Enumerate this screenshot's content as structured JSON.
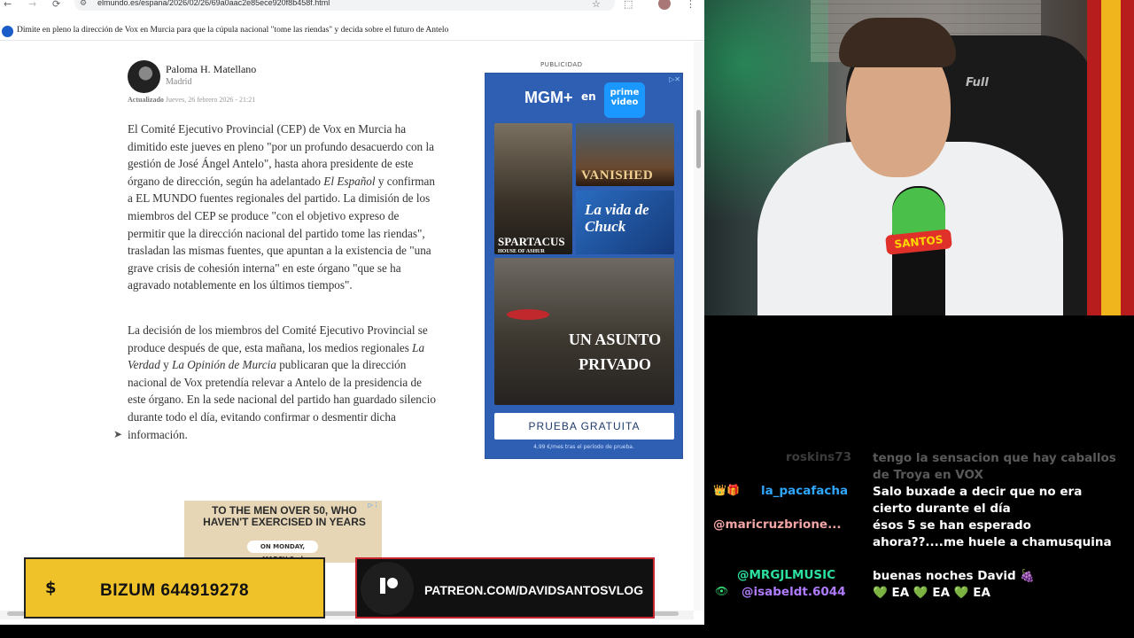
{
  "browser": {
    "url": "elmundo.es/espana/2026/02/26/69a0aac2e85ece920f8b458f.html",
    "tab_title": "Dimite en pleno la dirección de Vox en Murcia para que la cúpula nacional \"tome las riendas\" y decida sobre el futuro de Antelo",
    "icons": {
      "back": "←",
      "forward": "→",
      "reload": "⟳",
      "star": "☆",
      "extensions": "⬚",
      "menu": "⋮"
    }
  },
  "article": {
    "author_name": "Paloma H. Matellano",
    "author_city": "Madrid",
    "updated_label": "Actualizado",
    "updated_date": "Jueves, 26 febrero 2026 - 21:21",
    "paragraph1": {
      "a": "El Comité Ejecutivo Provincial (CEP) de Vox en Murcia ha dimitido este jueves en pleno \"por un profundo desacuerdo con la gestión de José Ángel Antelo\", hasta ahora presidente de este órgano de dirección, según ha adelantado ",
      "source": "El Español",
      "b": " y confirman a EL MUNDO fuentes regionales del partido. La dimisión de los miembros del CEP se produce \"con el objetivo expreso de permitir que la dirección nacional del partido tome las riendas\", trasladan las mismas fuentes, que apuntan a la existencia de \"una grave crisis de cohesión interna\" en este órgano \"que se ha agravado notablemente en los últimos tiempos\"."
    },
    "paragraph2": {
      "a": "La decisión de los miembros del Comité Ejecutivo Provincial se produce después de que, esta mañana, los medios regionales ",
      "source1": "La Verdad",
      "mid": " y ",
      "source2": "La Opinión de Murcia",
      "b": " publicaran que la dirección nacional de Vox pretendía relevar a Antelo de la presidencia de este órgano. En la sede nacional del partido han guardado silencio durante todo el día, evitando confirmar o desmentir dicha información."
    }
  },
  "ad": {
    "label": "PUBLICIDAD",
    "brand": "MGM+",
    "en": "en",
    "prime": "prime video",
    "poster1_title": "SPARTACUS",
    "poster1_sub": "HOUSE OF ASHUR",
    "poster2_title": "VANISHED",
    "poster3_title": "La vida de Chuck",
    "poster4_title": "UN ASUNTO PRIVADO",
    "cta": "PRUEBA GRATUITA",
    "fine_print": "4,99 €/mes tras el período de prueba."
  },
  "ad2": {
    "headline": "TO THE MEN OVER 50, WHO HAVEN'T EXERCISED IN YEARS",
    "badge": "ON MONDAY, MARCH 2nd",
    "sub": "nge ort?"
  },
  "banners": {
    "bizum_symbol": "$",
    "bizum_text": "BIZUM 644919278",
    "patreon_text": "PATREON.COM/DAVIDSANTOSVLOG"
  },
  "webcam": {
    "chair_text": "Full",
    "mic_label": "SANTOS"
  },
  "chat": [
    {
      "user": "roskins73",
      "message": "tengo la sensacion que hay caballos de Troya en VOX",
      "badge": ""
    },
    {
      "user": "la_pacafacha",
      "message": "Salo buxade a decir que no era cierto durante el día",
      "badge": "👑🎁"
    },
    {
      "user": "@maricruzbrione...",
      "message": "ésos 5 se han esperado ahora??....me huele a chamusquina",
      "badge": ""
    },
    {
      "user": "@MRGJLMUSIC",
      "message": "buenas noches David 🍇",
      "badge": ""
    },
    {
      "user": "@isabeldt.6044",
      "message_parts": [
        "💚",
        " EA ",
        "💚",
        " EA ",
        "💚",
        " EA"
      ],
      "badge": "👁"
    }
  ],
  "colors": {
    "chat_user_2": "#2fa7ff",
    "chat_user_3": "#f2a5a5",
    "chat_user_4": "#2ce0a0",
    "chat_user_5": "#b07cff",
    "bizum_bg": "#f0c22a",
    "patreon_border": "#c8242f",
    "ad_bg": "#2e5fb3"
  }
}
